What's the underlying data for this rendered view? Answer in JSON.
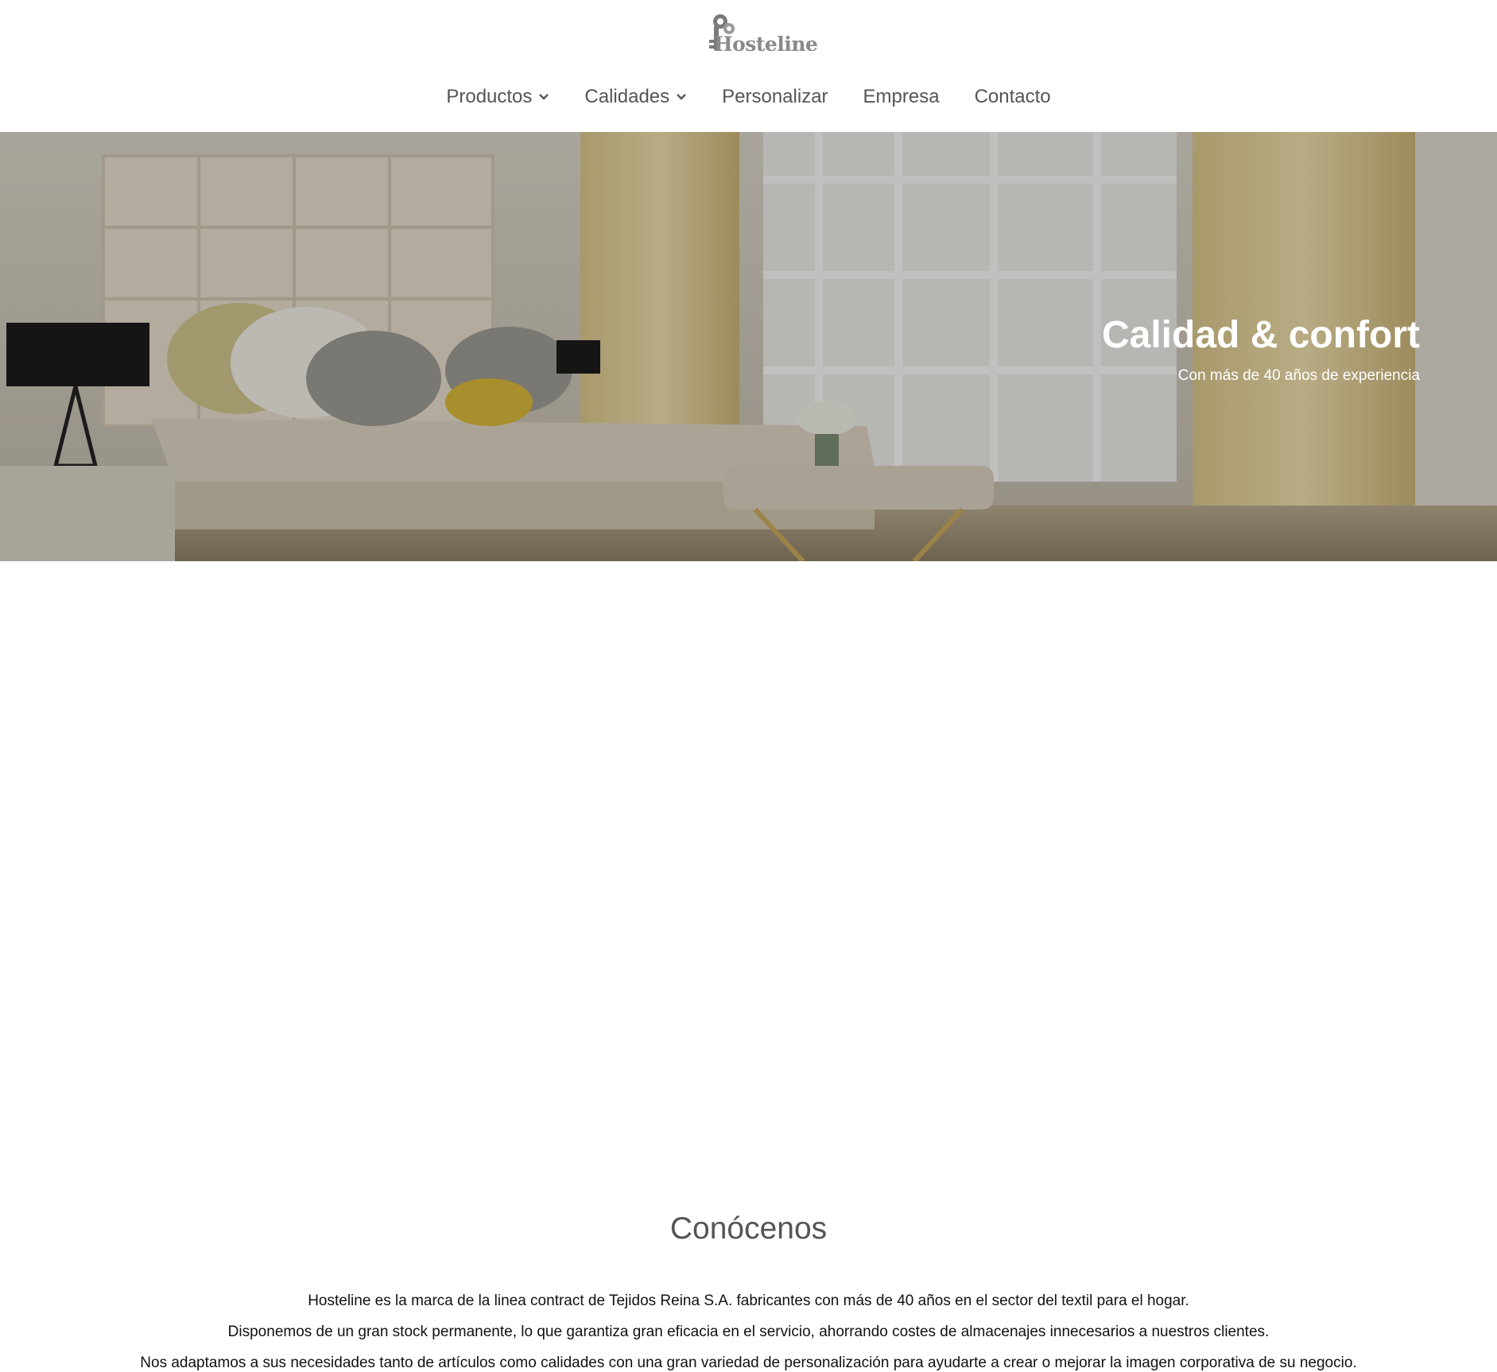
{
  "brand": {
    "logo_text": "Hosteline",
    "logo_icon": "key-logo-icon"
  },
  "nav": {
    "items": [
      {
        "label": "Productos",
        "has_dropdown": true
      },
      {
        "label": "Calidades",
        "has_dropdown": true
      },
      {
        "label": "Personalizar",
        "has_dropdown": false
      },
      {
        "label": "Empresa",
        "has_dropdown": false
      },
      {
        "label": "Contacto",
        "has_dropdown": false
      }
    ]
  },
  "hero": {
    "title": "Calidad & confort",
    "subtitle": "Con más de 40 años de experiencia"
  },
  "about": {
    "title": "Conócenos",
    "paragraphs": [
      "Hosteline es la marca de la linea contract de Tejidos Reina S.A. fabricantes con más de 40 años en el sector del textil para el hogar.",
      "Disponemos de un gran stock permanente, lo que garantiza gran eficacia en el servicio, ahorrando costes de almacenajes innecesarios a nuestros clientes.",
      "Nos adaptamos a sus necesidades tanto de artículos como calidades con una gran variedad de personalización para ayudarte a crear o mejorar la imagen corporativa de su negocio."
    ]
  },
  "colors": {
    "nav_text": "#555555",
    "hero_text": "#ffffff",
    "body_text": "#111111"
  }
}
